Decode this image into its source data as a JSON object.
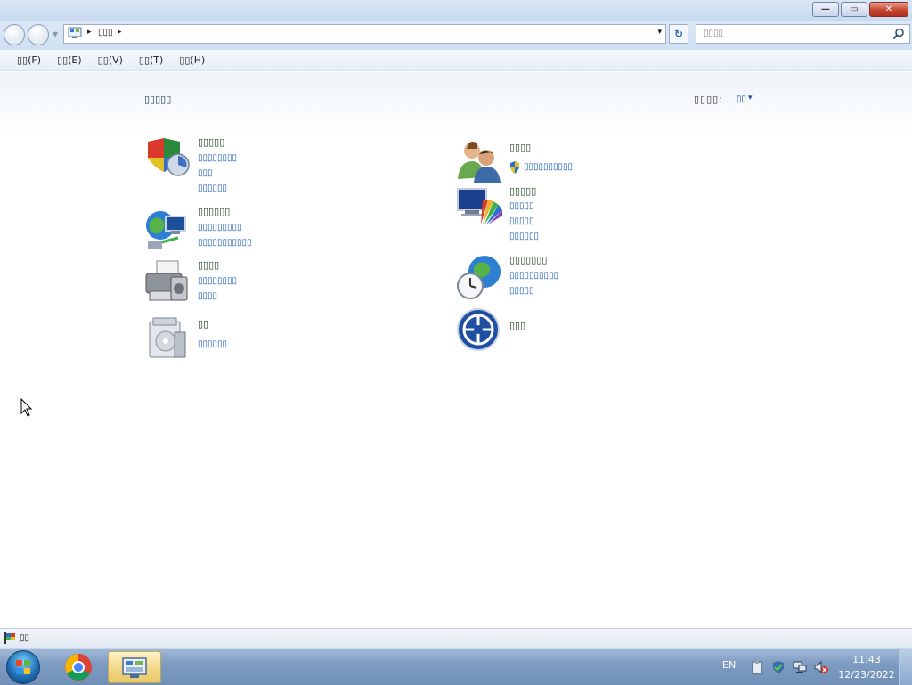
{
  "window": {
    "buttons": {
      "minimize": "—",
      "restore": "▭",
      "close": "✕"
    }
  },
  "address": {
    "crumb": "▯▯▯",
    "separator": "▸",
    "dropdown": "▾",
    "refresh": "↻"
  },
  "search": {
    "placeholder": "▯▯▯▯"
  },
  "menu": [
    {
      "label": "▯▯(F)"
    },
    {
      "label": "▯▯(E)"
    },
    {
      "label": "▯▯(V)"
    },
    {
      "label": "▯▯(T)"
    },
    {
      "label": "▯▯(H)"
    }
  ],
  "content": {
    "title": "▯▯▯▯▯",
    "view_by_label": "▯▯▯▯:",
    "view_by_value": "▯▯",
    "view_by_arrow": "▾"
  },
  "categories_left": [
    {
      "icon": "shield-icon",
      "title": "▯▯▯▯▯",
      "links": [
        "▯▯▯▯▯▯▯▯",
        "▯▯▯",
        "▯▯▯▯▯▯"
      ]
    },
    {
      "icon": "network-globe-icon",
      "title": "▯▯▯▯▯▯",
      "links": [
        "▯▯▯▯▯▯▯▯▯",
        "▯▯▯▯▯▯▯▯▯▯▯"
      ]
    },
    {
      "icon": "printer-icon",
      "title": "▯▯▯▯",
      "links": [
        "▯▯▯▯▯▯▯▯",
        "▯▯▯▯"
      ]
    },
    {
      "icon": "programs-icon",
      "title": "▯▯",
      "links": [
        "▯▯▯▯▯▯"
      ]
    }
  ],
  "categories_right": [
    {
      "icon": "users-icon",
      "title": "▯▯▯▯",
      "links": [
        "▯▯▯▯▯▯▯▯▯▯"
      ]
    },
    {
      "icon": "appearance-icon",
      "title": "▯▯▯▯▯",
      "links": [
        "▯▯▯▯▯",
        "▯▯▯▯▯",
        "▯▯▯▯▯▯"
      ]
    },
    {
      "icon": "clock-globe-icon",
      "title": "▯▯▯▯▯▯▯",
      "links": [
        "▯▯▯▯▯▯▯▯▯▯",
        "▯▯▯▯▯"
      ]
    },
    {
      "icon": "ease-of-access-icon",
      "title": "▯▯▯",
      "links": []
    }
  ],
  "status": {
    "text": "▯▯"
  },
  "taskbar": {
    "language": "EN",
    "time": "11:43",
    "date": "12/23/2022"
  }
}
